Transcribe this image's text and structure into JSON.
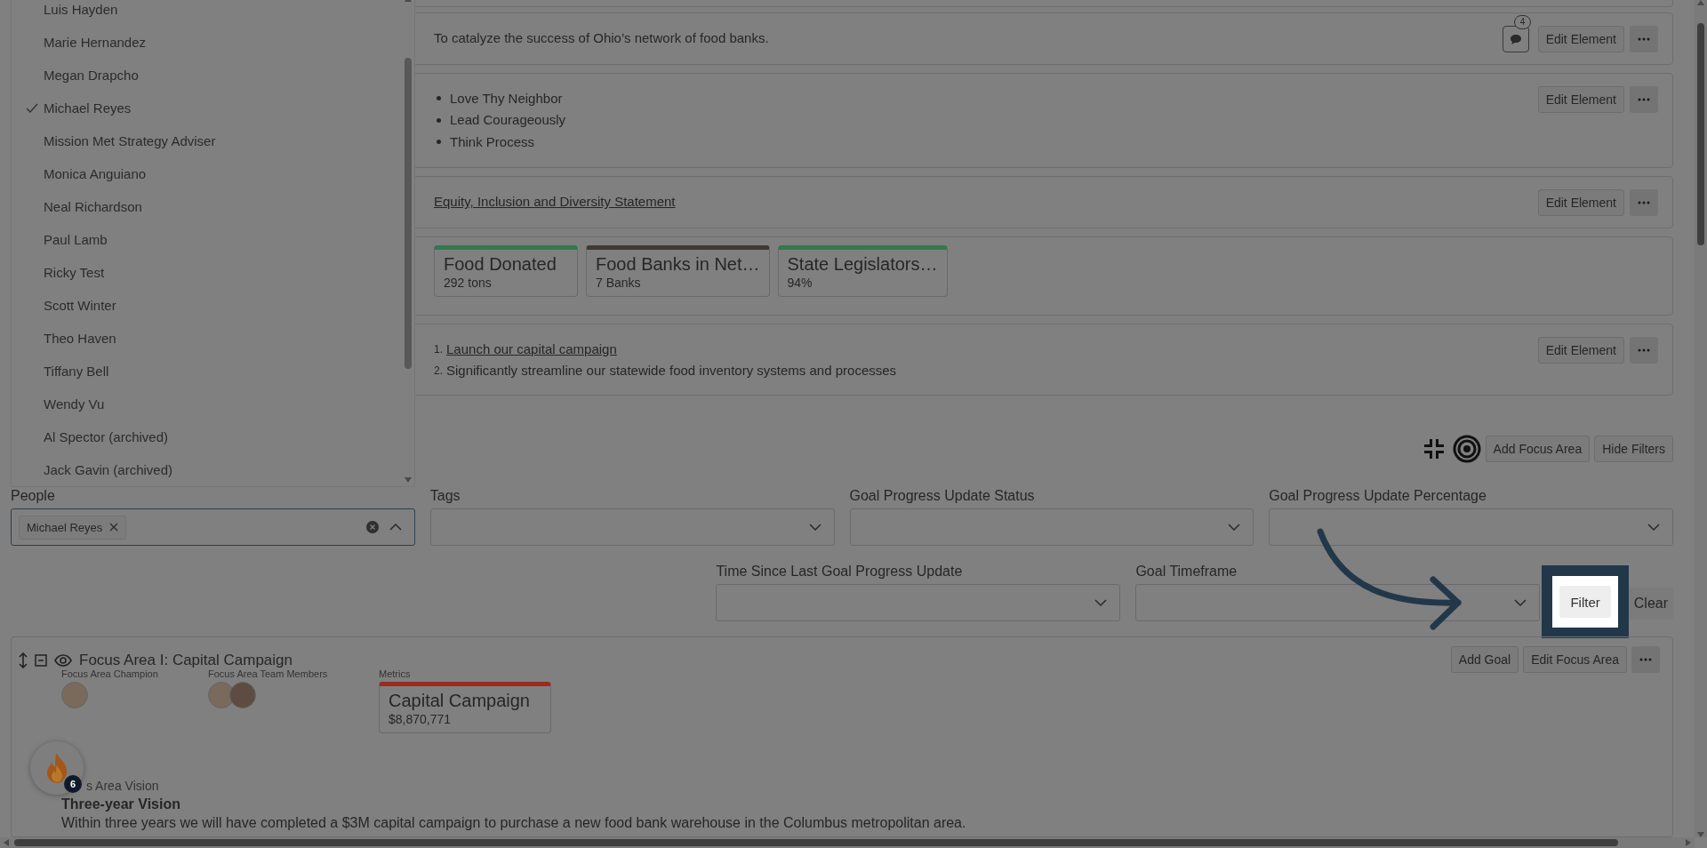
{
  "sections": [
    {
      "kind": "text",
      "text": "To catalyze the success of Ohio’s network of food banks.",
      "comments": "4",
      "button": "Edit Element"
    },
    {
      "kind": "bullets",
      "items": [
        "Love Thy Neighbor",
        "Lead Courageously",
        "Think Process"
      ],
      "button": "Edit Element"
    },
    {
      "kind": "link",
      "text": "Equity, Inclusion and Diversity Statement",
      "button": "Edit Element"
    },
    {
      "kind": "metrics",
      "metrics": [
        {
          "title": "Food Donated",
          "value": "292 tons",
          "color": "#2f7a4f"
        },
        {
          "title": "Food Banks in Net…",
          "value": "7 Banks",
          "color": "#403a36"
        },
        {
          "title": "State Legislators…",
          "value": "94%",
          "color": "#2f7a4f"
        }
      ]
    },
    {
      "kind": "numbered",
      "items": [
        {
          "number": "1.",
          "text": "Launch our capital campaign",
          "link": true
        },
        {
          "number": "2.",
          "text": "Significantly streamline our statewide food inventory systems and processes",
          "link": false
        }
      ],
      "button": "Edit Element"
    }
  ],
  "section_2": {
    "buttons": [
      "Add Focus Area",
      "Hide Filters"
    ]
  },
  "filter_rows": [
    {
      "fields": [
        {
          "label": "People",
          "kind": "multiselect",
          "open": true,
          "chips": [
            "Michael Reyes"
          ],
          "options": [
            {
              "name": "Luis Hayden",
              "selected": false
            },
            {
              "name": "Marie Hernandez",
              "selected": false
            },
            {
              "name": "Megan Drapcho",
              "selected": false
            },
            {
              "name": "Michael Reyes",
              "selected": true
            },
            {
              "name": "Mission Met Strategy Adviser",
              "selected": false
            },
            {
              "name": "Monica Anguiano",
              "selected": false
            },
            {
              "name": "Neal Richardson",
              "selected": false
            },
            {
              "name": "Paul Lamb",
              "selected": false
            },
            {
              "name": "Ricky Test",
              "selected": false
            },
            {
              "name": "Scott Winter",
              "selected": false
            },
            {
              "name": "Theo Haven",
              "selected": false
            },
            {
              "name": "Tiffany Bell",
              "selected": false
            },
            {
              "name": "Wendy Vu",
              "selected": false
            },
            {
              "name": "Al Spector (archived)",
              "selected": false
            },
            {
              "name": "Jack Gavin (archived)",
              "selected": false
            }
          ]
        },
        {
          "label": "Tags",
          "kind": "select"
        },
        {
          "label": "Goal Progress Update Status",
          "kind": "select"
        },
        {
          "label": "Goal Progress Update Percentage",
          "kind": "select"
        }
      ]
    },
    {
      "fields": [
        {
          "label": "Time Since Last Goal Progress Update",
          "kind": "select"
        },
        {
          "label": "Goal Timeframe",
          "kind": "select"
        }
      ]
    }
  ],
  "filter_button": {
    "label": "Filter",
    "highlighted": true
  },
  "clear_button": "Clear",
  "focus_area": {
    "title": "Focus Area I: Capital Campaign",
    "buttons": [
      "Add Goal",
      "Edit Focus Area"
    ],
    "champion_label": "Focus Area Champion",
    "team_label": "Focus Area Team Members",
    "metrics_label": "Metrics",
    "metric": {
      "title": "Capital Campaign",
      "value": "$8,870,771",
      "color": "#9b2a20"
    },
    "vision_label": "s Area Vision",
    "vision_title": "Three-year Vision",
    "vision_text": "Within three years we will have completed a $3M capital campaign to purchase a new food bank warehouse in the Columbus metropolitan area."
  },
  "notifications": {
    "count": "6"
  }
}
